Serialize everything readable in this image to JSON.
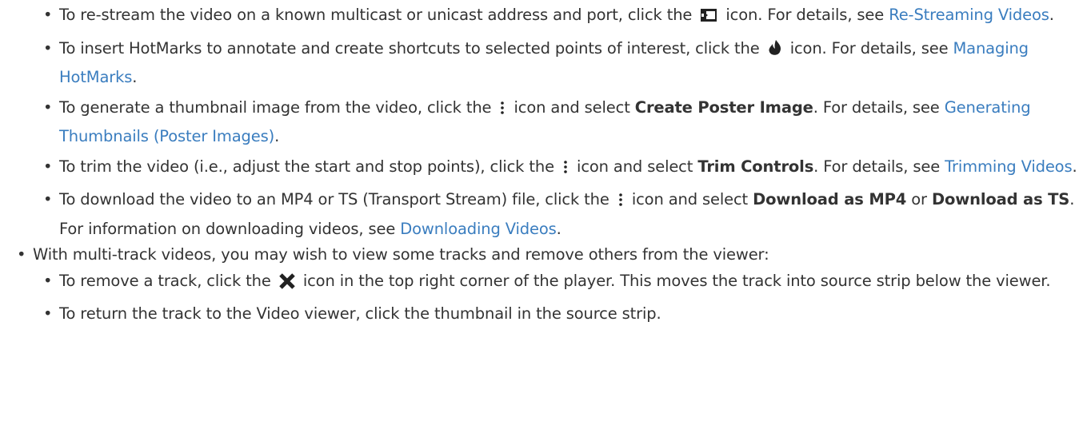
{
  "items": {
    "restream": {
      "before": "To re-stream the video on a known multicast or unicast address and port, click the",
      "after": "icon. For details, see",
      "link": "Re-Streaming Videos",
      "end": ".",
      "icon": "restream-icon"
    },
    "hotmarks": {
      "before": "To insert HotMarks to annotate and create shortcuts to selected points of interest, click the",
      "after": "icon. For details, see",
      "link": "Managing HotMarks",
      "end": ".",
      "icon": "hotmark-flame-icon"
    },
    "poster": {
      "before": "To generate a thumbnail image from the video, click the",
      "after": "icon and select",
      "bold": "Create Poster Image",
      "mid": ". For details, see",
      "link": "Generating Thumbnails (Poster Images)",
      "end": ".",
      "icon": "more-vertical-icon"
    },
    "trim": {
      "before": "To trim the video (i.e., adjust the start and stop points), click the",
      "after": "icon and select",
      "bold": "Trim Controls",
      "mid": ". For details, see",
      "link": "Trimming Videos",
      "end": ".",
      "icon": "more-vertical-icon"
    },
    "download": {
      "before": "To download the video to an MP4 or TS (Transport Stream) file, click the",
      "after": "icon and select",
      "bold1": "Download as MP4",
      "or": "or",
      "bold2": "Download as TS",
      "mid": ". For information on downloading videos, see",
      "link": "Downloading Videos",
      "end": ".",
      "icon": "more-vertical-icon"
    },
    "multitrack": {
      "text": "With multi-track videos, you may wish to view some tracks and remove others from the viewer:",
      "remove": {
        "before": "To remove a track, click the",
        "after": "icon in the top right corner of the player. This moves the track into source strip below the viewer.",
        "icon": "close-x-icon"
      },
      "return": {
        "text": "To return the track to the Video viewer, click the thumbnail in the source strip."
      }
    }
  },
  "colors": {
    "text": "#333333",
    "link": "#3a7dbf"
  }
}
